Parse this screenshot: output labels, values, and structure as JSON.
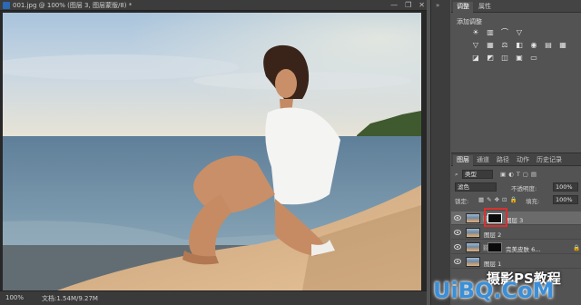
{
  "document": {
    "title": "001.jpg @ 100% (图层 3, 图层蒙版/8) *",
    "window_controls": [
      "—",
      "❐",
      "✕"
    ],
    "zoom": "100%",
    "status_doc": "文档:1.54M/9.27M"
  },
  "adjustments_panel": {
    "tabs": [
      "调整",
      "属性"
    ],
    "active_tab": "调整",
    "title": "添加调整",
    "icon_rows": [
      [
        "brightness-icon",
        "levels-icon",
        "curves-icon",
        "exposure-icon"
      ],
      [
        "vibrance-icon",
        "hue-saturation-icon",
        "color-balance-icon",
        "black-white-icon",
        "photo-filter-icon",
        "channel-mixer-icon",
        "color-lookup-icon"
      ],
      [
        "invert-icon",
        "posterize-icon",
        "threshold-icon",
        "selective-color-icon",
        "gradient-map-icon"
      ]
    ],
    "icon_glyphs": [
      [
        "☀",
        "▥",
        "⌒",
        "▽"
      ],
      [
        "▽",
        "▦",
        "⚖",
        "◧",
        "◉",
        "▤",
        "▦"
      ],
      [
        "◪",
        "◩",
        "◫",
        "▣",
        "▭"
      ]
    ]
  },
  "layers_panel": {
    "tabs": [
      "图层",
      "通道",
      "路径",
      "动作",
      "历史记录"
    ],
    "active_tab": "图层",
    "filter_kind": "类型",
    "blend_mode": "滤色",
    "opacity_label": "不透明度:",
    "opacity_value": "100%",
    "lock_label": "锁定:",
    "fill_label": "填充:",
    "fill_value": "100%",
    "layers": [
      {
        "name": "图层 3",
        "selected": true,
        "has_mask": true
      },
      {
        "name": "图层 2",
        "selected": false,
        "has_mask": false
      },
      {
        "name": "完美皮肤 6...",
        "selected": false,
        "has_mask": true
      },
      {
        "name": "图层 1",
        "selected": false,
        "has_mask": false
      }
    ]
  },
  "watermark": {
    "line1": "摄影PS教程",
    "line2": "UiBQ.CoM"
  },
  "colors": {
    "accent_red": "#d9312e",
    "panel_bg": "#535353",
    "watermark_blue": "#3a8fd8"
  }
}
